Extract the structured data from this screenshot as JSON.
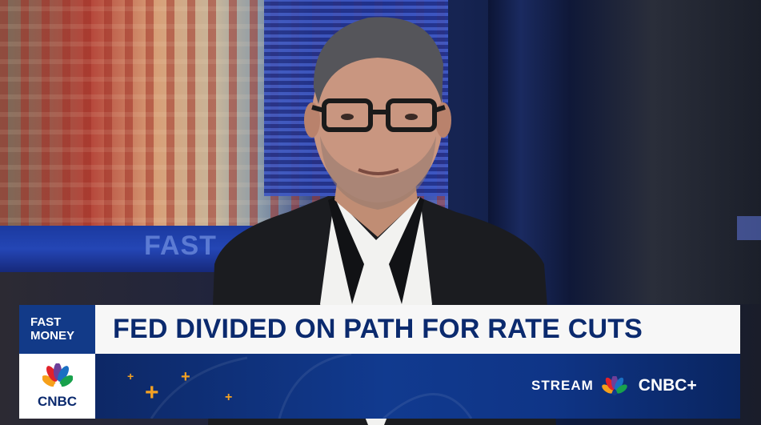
{
  "show": {
    "name_line1": "FAST",
    "name_line2": "MONEY"
  },
  "headline": "FED DIVIDED ON PATH FOR RATE CUTS",
  "network": {
    "logo_label": "CNBC"
  },
  "stream": {
    "label": "STREAM",
    "service": "CNBC+"
  },
  "background": {
    "ticker_text": "FAST"
  },
  "colors": {
    "navy": "#0b2a6e",
    "show_box": "#123a88",
    "headline_bg": "#f7f7f7",
    "accent_orange": "#f3a123"
  },
  "icons": [
    "nbc-peacock-icon",
    "plus-decoration-icon"
  ]
}
